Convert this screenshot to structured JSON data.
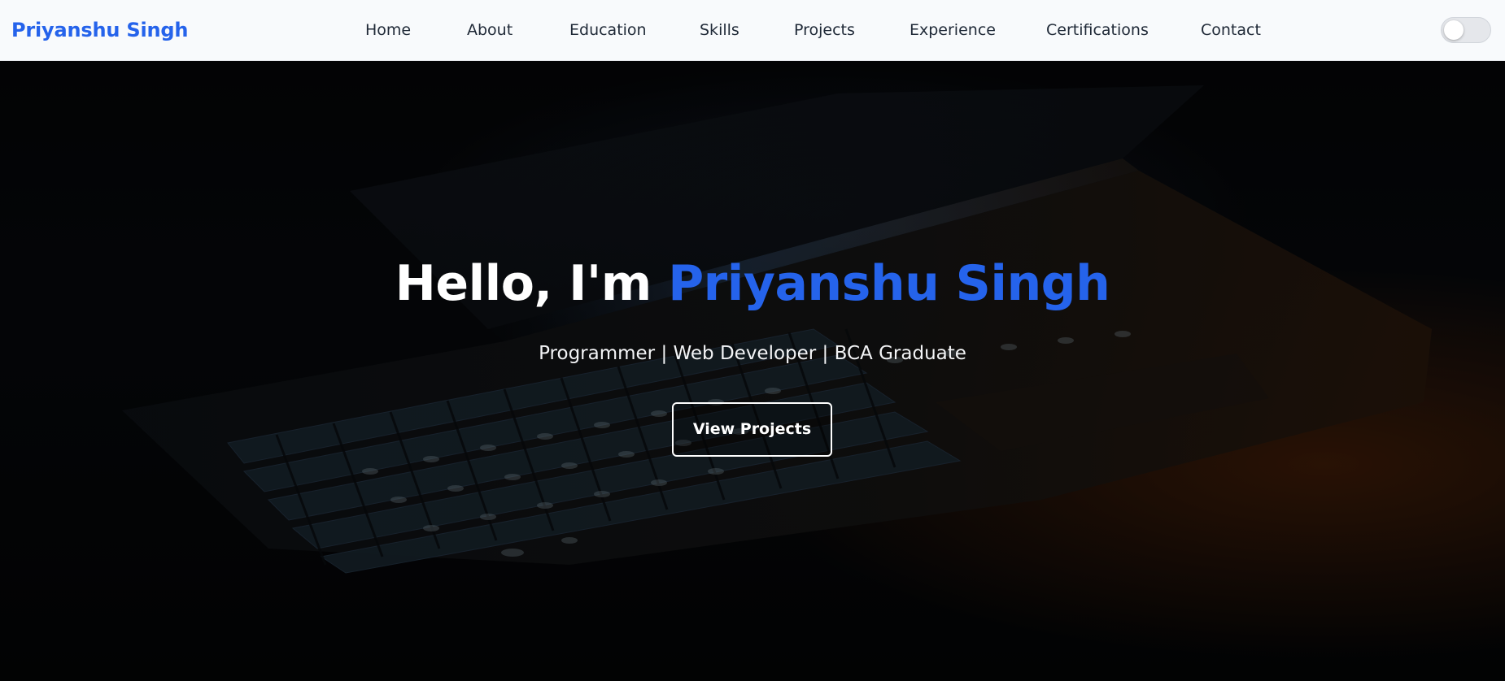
{
  "brand": {
    "name": "Priyanshu Singh",
    "color": "#2563eb"
  },
  "nav": {
    "items": [
      {
        "label": "Home"
      },
      {
        "label": "About"
      },
      {
        "label": "Education"
      },
      {
        "label": "Skills"
      },
      {
        "label": "Projects"
      },
      {
        "label": "Experience"
      },
      {
        "label": "Certifications"
      },
      {
        "label": "Contact"
      }
    ]
  },
  "theme_toggle": {
    "icon": "toggle-switch-icon",
    "state": "off"
  },
  "hero": {
    "greeting": "Hello, I'm",
    "name": "Priyanshu Singh",
    "subtitle": "Programmer | Web Developer | BCA Graduate",
    "button_label": "View Projects",
    "background": "laptop-keyboard-dark-photo",
    "accent_color": "#2563eb"
  }
}
